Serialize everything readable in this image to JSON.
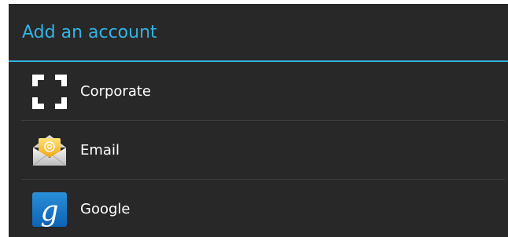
{
  "dialog": {
    "title": "Add an account"
  },
  "accounts": [
    {
      "label": "Corporate",
      "icon": "corporate-icon"
    },
    {
      "label": "Email",
      "icon": "email-icon"
    },
    {
      "label": "Google",
      "icon": "google-icon"
    }
  ],
  "colors": {
    "accent": "#33b5e5",
    "background": "#282828",
    "text": "#ffffff"
  }
}
